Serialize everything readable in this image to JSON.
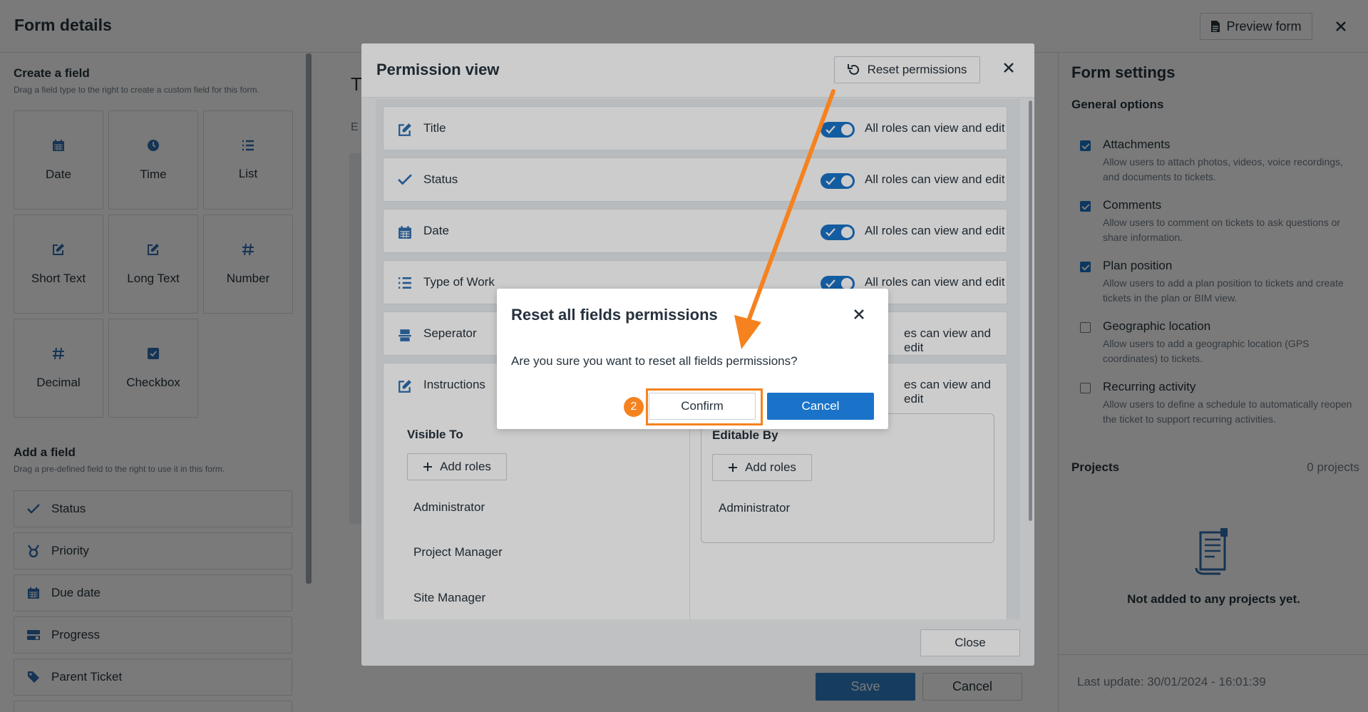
{
  "header": {
    "title": "Form details",
    "preview_label": "Preview form"
  },
  "left_panel": {
    "create_title": "Create a field",
    "create_subtitle": "Drag a field type to the right to create a custom field for this form.",
    "tiles": [
      {
        "label": "Date",
        "icon": "calendar-icon"
      },
      {
        "label": "Time",
        "icon": "clock-icon"
      },
      {
        "label": "List",
        "icon": "list-icon"
      },
      {
        "label": "Short Text",
        "icon": "edit-icon"
      },
      {
        "label": "Long Text",
        "icon": "edit-icon"
      },
      {
        "label": "Number",
        "icon": "hash-icon"
      },
      {
        "label": "Decimal",
        "icon": "hash-icon"
      },
      {
        "label": "Checkbox",
        "icon": "checkbox-icon"
      }
    ],
    "add_title": "Add a field",
    "add_subtitle": "Drag a pre-defined field to the right to use it in this form.",
    "fields": [
      {
        "label": "Status",
        "icon": "check-icon"
      },
      {
        "label": "Priority",
        "icon": "medal-icon"
      },
      {
        "label": "Due date",
        "icon": "calendar-icon"
      },
      {
        "label": "Progress",
        "icon": "progress-icon"
      },
      {
        "label": "Parent Ticket",
        "icon": "tag-icon"
      }
    ]
  },
  "center": {
    "fragment_title": "T",
    "fragment_sub": "E",
    "save_label": "Save",
    "cancel_label": "Cancel"
  },
  "right_panel": {
    "title": "Form settings",
    "general_title": "General options",
    "options": [
      {
        "label": "Attachments",
        "checked": true,
        "description": "Allow users to attach photos, videos, voice recordings, and documents to tickets."
      },
      {
        "label": "Comments",
        "checked": true,
        "description": "Allow users to comment on tickets to ask questions or share information."
      },
      {
        "label": "Plan position",
        "checked": true,
        "description": "Allow users to add a plan position to tickets and create tickets in the plan or BIM view."
      },
      {
        "label": "Geographic location",
        "checked": false,
        "description": "Allow users to add a geographic location (GPS coordinates) to tickets."
      },
      {
        "label": "Recurring activity",
        "checked": false,
        "description": "Allow users to define a schedule to automatically reopen the ticket to support recurring activities."
      }
    ],
    "projects_title": "Projects",
    "projects_count": "0 projects",
    "no_projects": "Not added to any projects yet.",
    "last_update": "Last update: 30/01/2024 - 16:01:39"
  },
  "permission_modal": {
    "title": "Permission view",
    "reset_label": "Reset permissions",
    "rows": [
      {
        "name": "Title",
        "icon": "edit-icon",
        "roles": "All roles can view and edit"
      },
      {
        "name": "Status",
        "icon": "check-icon",
        "roles": "All roles can view and edit"
      },
      {
        "name": "Date",
        "icon": "calendar-icon",
        "roles": "All roles can view and edit"
      },
      {
        "name": "Type of Work",
        "icon": "list-icon",
        "roles": "All roles can view and edit"
      },
      {
        "name": "Seperator",
        "icon": "separator-icon",
        "roles": "es can view and edit"
      },
      {
        "name": "Instructions",
        "icon": "edit-icon",
        "roles": "es can view and edit"
      }
    ],
    "visible_to": {
      "title": "Visible To",
      "add_label": "Add roles",
      "roles": [
        "Administrator",
        "Project Manager",
        "Site Manager"
      ]
    },
    "editable_by": {
      "title": "Editable By",
      "add_label": "Add roles",
      "roles": [
        "Administrator"
      ]
    },
    "close_label": "Close"
  },
  "confirm_dialog": {
    "title": "Reset all fields permissions",
    "message": "Are you sure you want to reset all fields permissions?",
    "confirm_label": "Confirm",
    "cancel_label": "Cancel",
    "step_number": "2"
  },
  "colors": {
    "primary": "#1a73c9",
    "annotation": "#f5821f",
    "overlay": "#000000"
  }
}
